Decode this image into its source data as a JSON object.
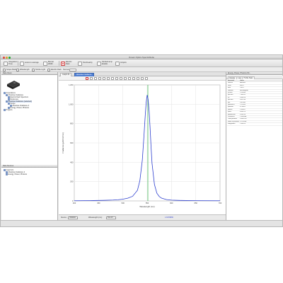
{
  "window": {
    "title": "Ocean Optics SpectraSuite"
  },
  "toolbar1": {
    "buttons": [
      {
        "label": "Integration Time"
      },
      {
        "label": "scans to average"
      },
      {
        "label": "Boxcar Width"
      },
      {
        "label": "Electric Dark"
      },
      {
        "label": "Nonlinearity"
      },
      {
        "label": "Strobe/Lamp Enable"
      },
      {
        "label": "Acquire"
      }
    ]
  },
  "toolbar2": {
    "items": [
      {
        "label": "Scope Mode"
      },
      {
        "label": "Wavelength"
      },
      {
        "label": "Strobe Light"
      },
      {
        "label": "Electric Dark"
      },
      {
        "label": "Normal"
      }
    ]
  },
  "left_panel": {
    "header": "Data Views",
    "tree": [
      {
        "label": "Acquisitions",
        "depth": 0
      },
      {
        "label": "Absolute Irradiance",
        "depth": 1
      },
      {
        "label": "Electric Dark Spectrum",
        "depth": 2
      },
      {
        "label": "Reference",
        "depth": 2
      },
      {
        "label": "Absolute Irradiance (selected)",
        "depth": 1
      },
      {
        "label": "Scope",
        "depth": 2
      },
      {
        "label": "Absolute Irradiance 4",
        "depth": 3
      },
      {
        "label": "Energy, Power, Photons",
        "depth": 2
      },
      {
        "label": "Projects",
        "depth": 0
      }
    ],
    "lower_header": "Data Sources",
    "lower_tree": [
      {
        "label": "Graph #1",
        "depth": 0
      },
      {
        "label": "Absolute Irradiance 2",
        "depth": 1
      },
      {
        "label": "Energy, Power, Photons",
        "depth": 1
      }
    ]
  },
  "center": {
    "tabs": [
      {
        "label": "Graph #1",
        "active": false
      },
      {
        "label": "Absolute Irradiance",
        "active": true
      }
    ],
    "status": {
      "source_label": "Source:",
      "source_value": "HR4000",
      "wavelength_label": "Wavelength (nm):",
      "wavelength_value": "551.45",
      "value_label": "1.8179836"
    }
  },
  "chart_data": {
    "type": "line",
    "title": "",
    "xlabel": "Wavelength (nm)",
    "ylabel": "Irradiance (µW/cm²/nm)",
    "xlim": [
      400,
      700
    ],
    "ylim": [
      0,
      1200
    ],
    "xticks": [
      400,
      450,
      500,
      550,
      600,
      650,
      700
    ],
    "yticks": [
      0,
      200,
      400,
      600,
      800,
      1000,
      1200
    ],
    "grid": true,
    "marker_x": 551.45,
    "series": [
      {
        "color": "#2d3fcf",
        "x": [
          400,
          420,
          440,
          460,
          480,
          490,
          500,
          510,
          520,
          530,
          535,
          540,
          543,
          546,
          548,
          550,
          552,
          554,
          556,
          558,
          560,
          565,
          570,
          575,
          580,
          590,
          600,
          620,
          650,
          700
        ],
        "y": [
          2,
          3,
          4,
          6,
          9,
          12,
          18,
          28,
          48,
          110,
          210,
          420,
          640,
          880,
          1020,
          1095,
          1050,
          930,
          760,
          560,
          390,
          170,
          80,
          45,
          28,
          14,
          8,
          5,
          3,
          2
        ]
      }
    ]
  },
  "right_panel": {
    "header": "Energy, Power, Photons Wi...",
    "tabs": [
      {
        "label": "Energy",
        "active": false
      },
      {
        "label": "Log",
        "active": false
      },
      {
        "label": "Profile Stats",
        "active": true
      }
    ],
    "table_header": {
      "k": "Attribute",
      "v": "Value"
    },
    "rows": [
      {
        "k": "Source",
        "v": "HR4000"
      },
      {
        "k": "Start",
        "v": "400.0"
      },
      {
        "k": "End",
        "v": "700.0"
      },
      {
        "k": "Method",
        "v": "Rectangular"
      },
      {
        "k": "µJ/cm²",
        "v": "1.23456"
      },
      {
        "k": "µW/cm²",
        "v": "7.89012"
      },
      {
        "k": "µJ",
        "v": "3.45678"
      },
      {
        "k": "µW/cm²",
        "v": "9.01234"
      },
      {
        "k": "µW",
        "v": "5.67890"
      },
      {
        "k": "µmol/m²/s",
        "v": "1.12345"
      },
      {
        "k": "µmol/m²",
        "v": "6.78901"
      },
      {
        "k": "µmol/s",
        "v": "2.34567"
      },
      {
        "k": "µmol",
        "v": "8.90123"
      },
      {
        "k": "photons/m²",
        "v": "4.56789"
      },
      {
        "k": "Photons/s",
        "v": "1.34568E"
      },
      {
        "k": "Total photons",
        "v": "3.45E+03"
      },
      {
        "k": "Mean of photons",
        "v": "5.12345E"
      },
      {
        "k": "Integration",
        "v": "1.09876"
      }
    ]
  }
}
